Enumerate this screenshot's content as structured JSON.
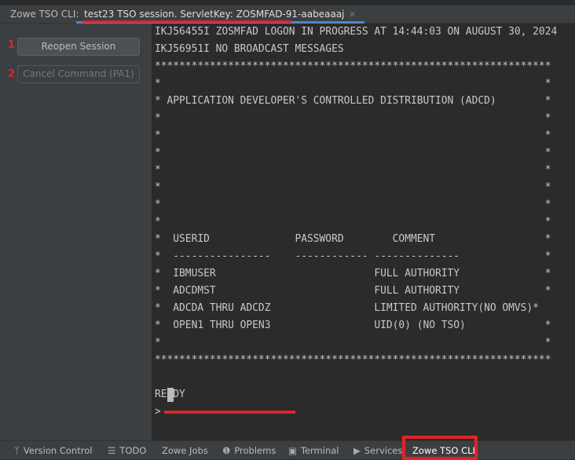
{
  "tabbar": {
    "label": "Zowe TSO CLI:",
    "tab_title": "test23 TSO session. ServletKey: ZOSMFAD-91-aabeaaaj",
    "close": "×"
  },
  "left": {
    "buttons": [
      {
        "num": "1",
        "label": "Reopen Session",
        "enabled": true
      },
      {
        "num": "2",
        "label": "Cancel Command (PA1)",
        "enabled": false
      }
    ]
  },
  "terminal": {
    "lines": [
      "IKJ56455I ZOSMFAD LOGON IN PROGRESS AT 14:44:03 ON AUGUST 30, 2024",
      "IKJ56951I NO BROADCAST MESSAGES",
      "*****************************************************************",
      "*                                                               *",
      "* APPLICATION DEVELOPER'S CONTROLLED DISTRIBUTION (ADCD)        *",
      "*                                                               *",
      "*                                                               *",
      "*                                                               *",
      "*                                                               *",
      "*                                                               *",
      "*                                                               *",
      "*                                                               *",
      "*  USERID              PASSWORD        COMMENT                  *",
      "*  ----------------    ------------ --------------              *",
      "*  IBMUSER                          FULL AUTHORITY              *",
      "*  ADCDMST                          FULL AUTHORITY              *",
      "*  ADCDA THRU ADCDZ                 LIMITED AUTHORITY(NO OMVS)*",
      "*  OPEN1 THRU OPEN3                 UID(0) (NO TSO)             *",
      "*                                                               *",
      "*****************************************************************",
      "",
      "READY",
      "> "
    ]
  },
  "bottom": {
    "items": [
      {
        "icon": "branch-icon",
        "glyph": "ᛘ",
        "label": "Version Control"
      },
      {
        "icon": "list-icon",
        "glyph": "☰",
        "label": "TODO"
      },
      {
        "icon": "",
        "glyph": "",
        "label": "Zowe Jobs"
      },
      {
        "icon": "problems-icon",
        "glyph": "❶",
        "label": "Problems"
      },
      {
        "icon": "terminal-icon",
        "glyph": "▣",
        "label": "Terminal"
      },
      {
        "icon": "services-icon",
        "glyph": "▶",
        "label": "Services"
      },
      {
        "icon": "",
        "glyph": "",
        "label": "Zowe TSO CLI",
        "active": true
      }
    ]
  },
  "colors": {
    "accent": "#4a88c7",
    "annotation": "#e0232b"
  }
}
